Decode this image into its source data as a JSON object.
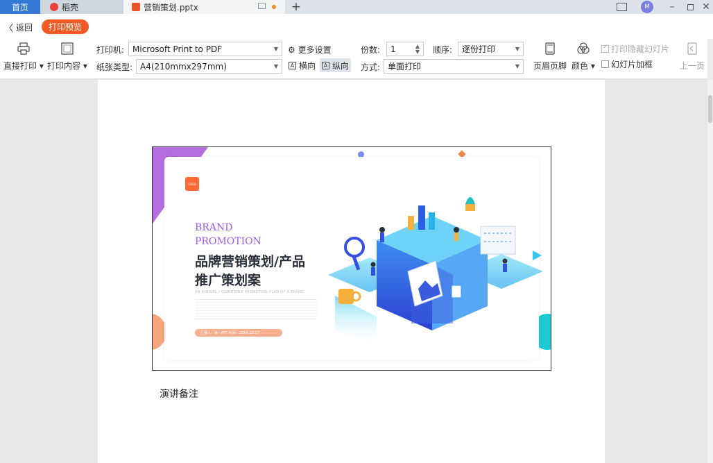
{
  "tabs": {
    "home": "首页",
    "daoke": "稻壳",
    "file": "营销策划.pptx",
    "add": "+"
  },
  "row2": {
    "back": "返回",
    "print_preview": "打印预览"
  },
  "toolbar": {
    "direct_print": "直接打印",
    "print_content": "打印内容",
    "printer_label": "打印机:",
    "printer_value": "Microsoft Print to PDF",
    "more_settings": "更多设置",
    "paper_label": "纸张类型:",
    "paper_value": "A4(210mmx297mm)",
    "landscape": "横向",
    "portrait": "纵向",
    "copies_label": "份数:",
    "copies_value": "1",
    "order_label": "顺序:",
    "order_value": "逐份打印",
    "mode_label": "方式:",
    "mode_value": "单面打印",
    "header_footer": "页眉页脚",
    "color": "颜色",
    "print_hidden": "打印隐藏幻灯片",
    "slide_frame": "幻灯片加框",
    "prev_page": "上一页"
  },
  "slide": {
    "brand_line1": "BRAND",
    "brand_line2": "PROMOTION",
    "title": "品牌营销策划/产品推广策划案",
    "subtitle": "AN ANNUAL / QUARTERLY PROMOTION PLAN OF A BRAND",
    "tag": "汇报人：第一PPT  时间：20XX.12.12",
    "logo_text": "LOGO"
  },
  "notes": "演讲备注",
  "window": {
    "avatar": "M"
  },
  "colors": {
    "accent": "#f15a24",
    "home_tab": "#3478d6",
    "brand": "#9b5de5"
  }
}
